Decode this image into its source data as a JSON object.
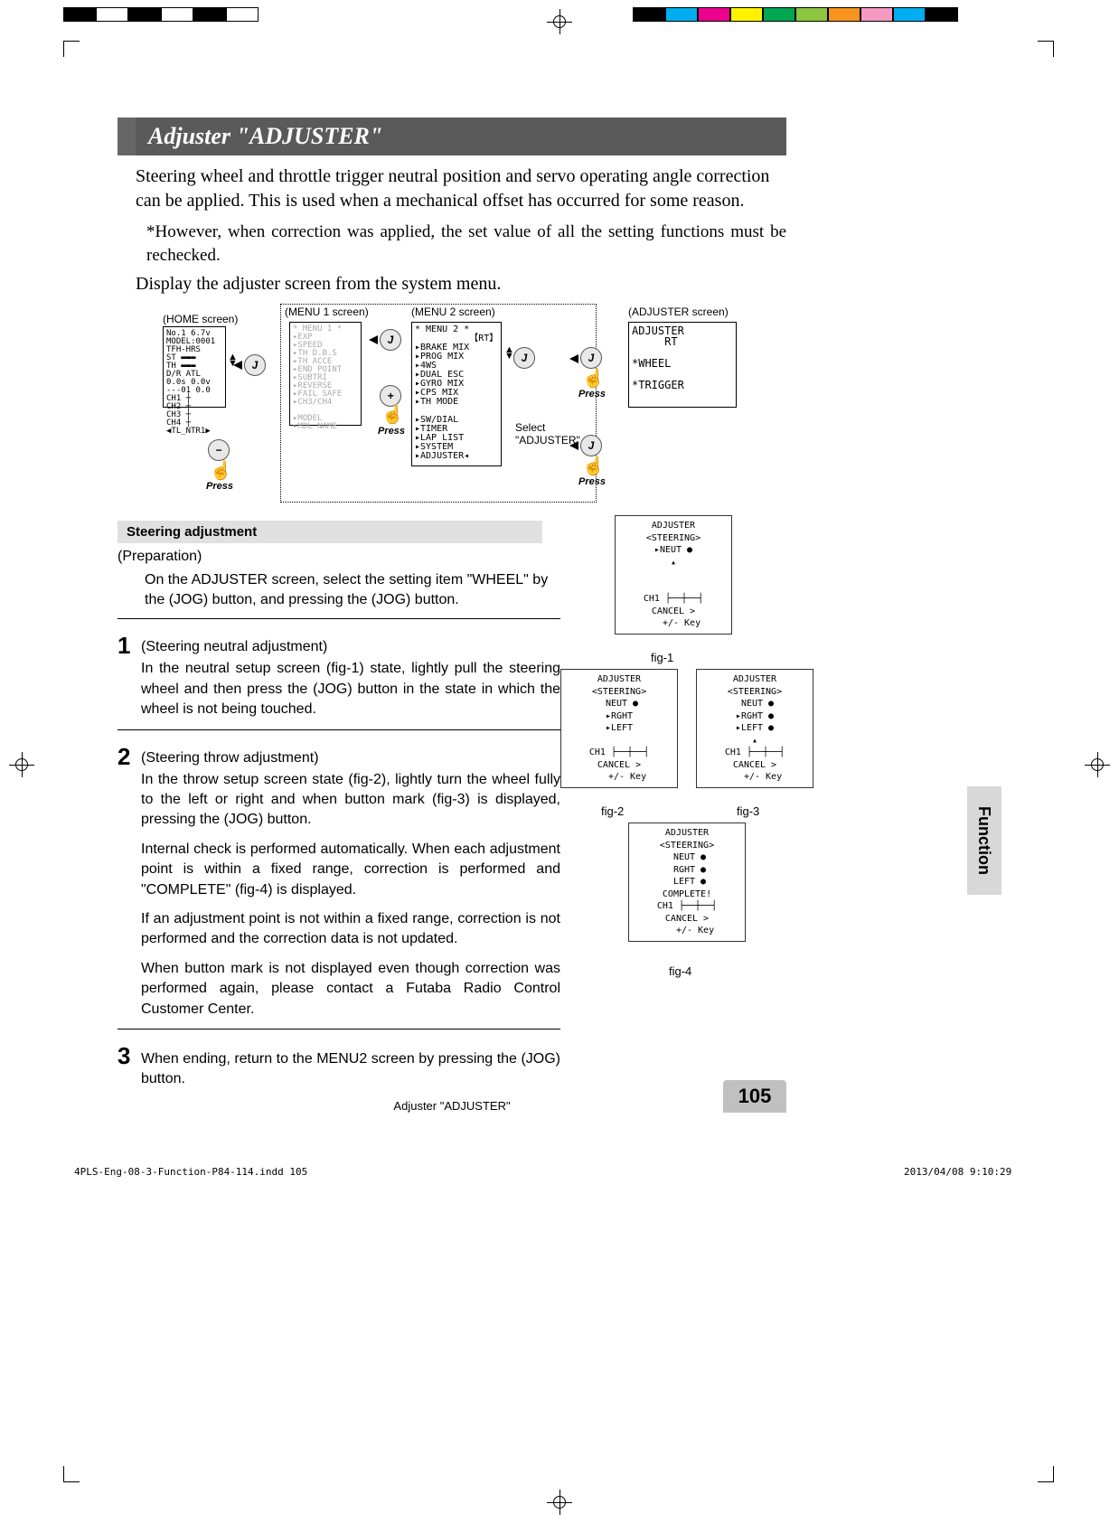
{
  "title": "Adjuster  \"ADJUSTER\"",
  "intro": "Steering wheel and throttle trigger neutral position and servo operating angle correction can be applied. This is used when a mechanical offset has occurred for some reason.",
  "note": "*However, when correction was applied, the set value of all the setting functions must be rechecked.",
  "display_instruction": "Display the adjuster screen from the system menu.",
  "nav": {
    "home_label": "(HOME screen)",
    "menu1_label": "(MENU 1 screen)",
    "menu2_label": "(MENU 2 screen)",
    "adjuster_label": "(ADJUSTER screen)",
    "jog": "J",
    "plus": "+",
    "minus": "−",
    "press": "Press",
    "select_text": "Select\n\"ADJUSTER\"",
    "menu1_items": "* MENU 1 *\n▸EXP\n▸SPEED\n▸TH D.B.S\n▸TH ACCE\n▸END POINT\n▸SUBTRI\n▸REVERSE\n▸FAIL SAFE\n▸CH3/CH4\n\n▸MODEL\n▸MDL NAME",
    "menu2_items": "* MENU 2 *\n          【RT】\n▸BRAKE MIX\n▸PROG MIX\n▸4WS\n▸DUAL ESC\n▸GYRO MIX\n▸CPS MIX\n▸TH MODE\n\n▸SW/DIAL\n▸TIMER\n▸LAP LIST\n▸SYSTEM\n▸ADJUSTER◂",
    "adjuster_items": "ADJUSTER\n     RT \n\n*WHEEL\n\n*TRIGGER"
  },
  "section_header": "Steering adjustment",
  "prep_label": "(Preparation)",
  "prep_text": "On the ADJUSTER screen, select the setting item \"WHEEL\" by the (JOG) button, and pressing the (JOG) button.",
  "steps": [
    {
      "num": "1",
      "title": "(Steering neutral adjustment)",
      "body": [
        "In the neutral setup screen (fig-1) state, lightly pull the steering wheel and then press the (JOG) button in the state in which the wheel is not being touched."
      ]
    },
    {
      "num": "2",
      "title": "(Steering throw adjustment)",
      "body": [
        "In the throw setup screen state (fig-2), lightly turn the wheel fully to the left or right and when button mark (fig-3) is displayed, pressing the (JOG) button.",
        "Internal check is performed automatically. When each adjustment point is within a fixed range, correction is performed and \"COMPLETE\" (fig-4) is displayed.",
        "If an adjustment point is not within a fixed range, correction is not performed and the correction data is not updated.",
        "When button mark is not displayed even though correction was performed again, please contact a Futaba Radio Control Customer Center."
      ]
    },
    {
      "num": "3",
      "title": "",
      "body": [
        "When ending, return to the MENU2 screen by pressing the (JOG) button."
      ]
    }
  ],
  "lcd": {
    "fig1": "ADJUSTER\n<STEERING>\n▸NEUT ●\n▴\n\n\nCH1 ├──┼──┤\nCANCEL >\n   +/- Key",
    "fig2": "ADJUSTER\n<STEERING>\n NEUT ●\n▸RGHT\n▸LEFT\n\nCH1 ├──┼──┤\nCANCEL >\n   +/- Key",
    "fig3": "ADJUSTER\n<STEERING>\n NEUT ●\n▸RGHT ●\n▸LEFT ●\n▴\nCH1 ├──┼──┤\nCANCEL >\n   +/- Key",
    "fig4": "ADJUSTER\n<STEERING>\n NEUT ●\n RGHT ●\n LEFT ●\nCOMPLETE!\nCH1 ├──┼──┤\nCANCEL >\n   +/- Key",
    "fig1_label": "fig-1",
    "fig2_label": "fig-2",
    "fig3_label": "fig-3",
    "fig4_label": "fig-4"
  },
  "side_tab": "Function",
  "footer_title": "Adjuster \"ADJUSTER\"",
  "page_num": "105",
  "file_meta": "4PLS-Eng-08-3-Function-P84-114.indd   105",
  "date_meta": "2013/04/08   9:10:29",
  "colors1": [
    "#000",
    "#fff",
    "#000",
    "#fff",
    "#000",
    "#fff",
    "#000",
    "#fff"
  ],
  "colors2": [
    "#000",
    "#00aeef",
    "#ec008c",
    "#fff200",
    "#00a651",
    "#8dc63f",
    "#f7941d",
    "#f49ac1",
    "#00adef",
    "#000"
  ]
}
